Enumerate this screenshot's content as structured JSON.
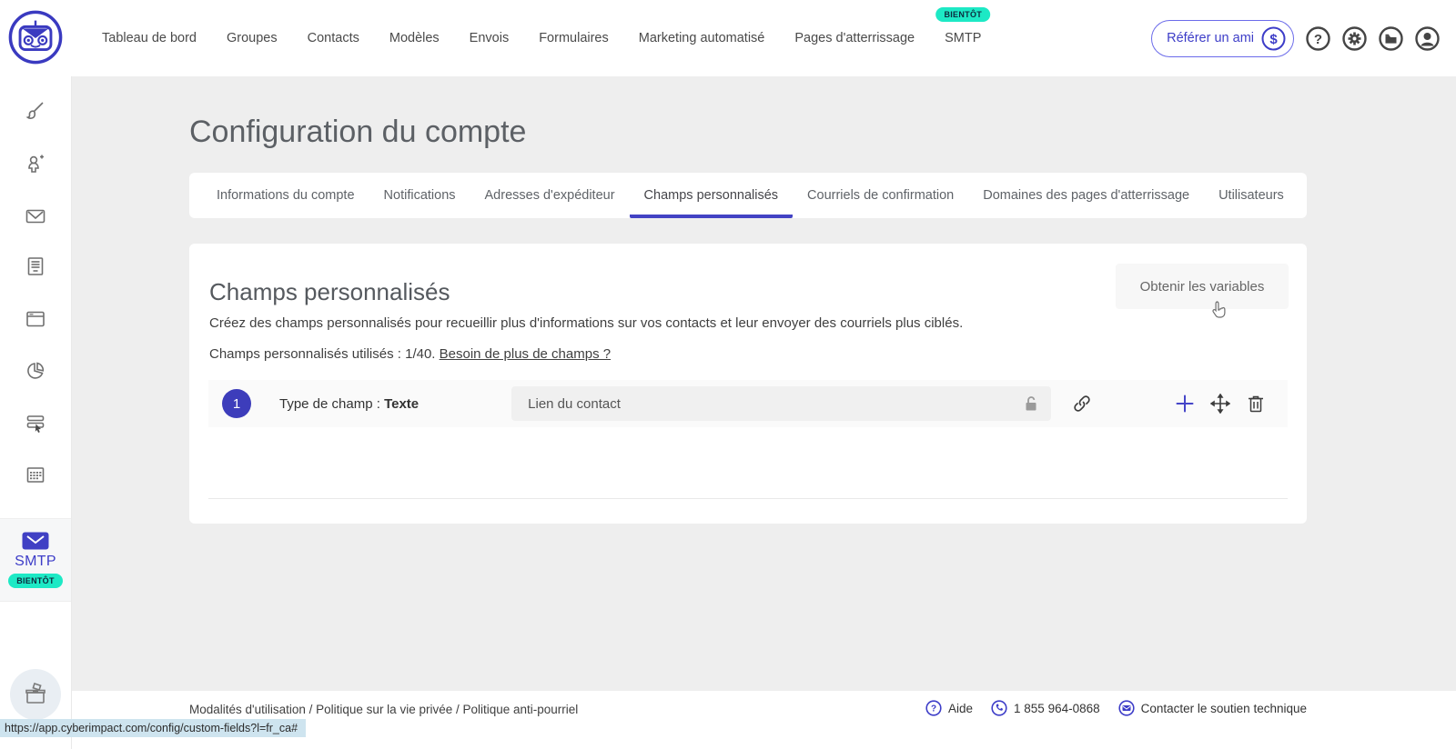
{
  "header": {
    "nav": [
      {
        "label": "Tableau de bord"
      },
      {
        "label": "Groupes"
      },
      {
        "label": "Contacts"
      },
      {
        "label": "Modèles"
      },
      {
        "label": "Envois"
      },
      {
        "label": "Formulaires"
      },
      {
        "label": "Marketing automatisé"
      },
      {
        "label": "Pages d'atterrissage"
      },
      {
        "label": "SMTP"
      }
    ],
    "smtp_badge": "BIENTÔT",
    "refer_button": "Référer un ami",
    "refer_symbol": "$",
    "icons": [
      "help-icon",
      "gear-icon",
      "folder-icon",
      "account-icon"
    ]
  },
  "sidebar": {
    "icons": [
      "brush-icon",
      "add-contact-icon",
      "envelope-icon",
      "document-icon",
      "browser-window-icon",
      "pie-chart-icon",
      "forms-icon",
      "calendar-icon"
    ],
    "smtp": {
      "label": "SMTP",
      "badge": "BIENTÔT"
    },
    "bottom_icon": "ballot-box-icon"
  },
  "page": {
    "title": "Configuration du compte"
  },
  "tabs": {
    "items": [
      {
        "label": "Informations du compte"
      },
      {
        "label": "Notifications"
      },
      {
        "label": "Adresses d'expéditeur"
      },
      {
        "label": "Champs personnalisés"
      },
      {
        "label": "Courriels de confirmation"
      },
      {
        "label": "Domaines des pages d'atterrissage"
      },
      {
        "label": "Utilisateurs"
      }
    ],
    "active": "Champs personnalisés"
  },
  "card": {
    "heading": "Champs personnalisés",
    "get_variables_button": "Obtenir les variables",
    "description": "Créez des champs personnalisés pour recueillir plus d'informations sur vos contacts et leur envoyer des courriels plus ciblés.",
    "usage_text": "Champs personnalisés utilisés : 1/40.",
    "more_fields_link": "Besoin de plus de champs ?",
    "field": {
      "number": "1",
      "type_label": "Type de champ : ",
      "type_value": "Texte",
      "value": "Lien du contact"
    }
  },
  "footer": {
    "legal": "Modalités d'utilisation / Politique sur la vie privée / Politique anti-pourriel",
    "help": "Aide",
    "phone": "1 855 964-0868",
    "contact": "Contacter le soutien technique"
  },
  "statusbar": {
    "url": "https://app.cyberimpact.com/config/custom-fields?l=fr_ca#"
  },
  "colors": {
    "primary": "#3d3dbb",
    "teal": "#1de9c5",
    "background": "#eeeeee"
  }
}
